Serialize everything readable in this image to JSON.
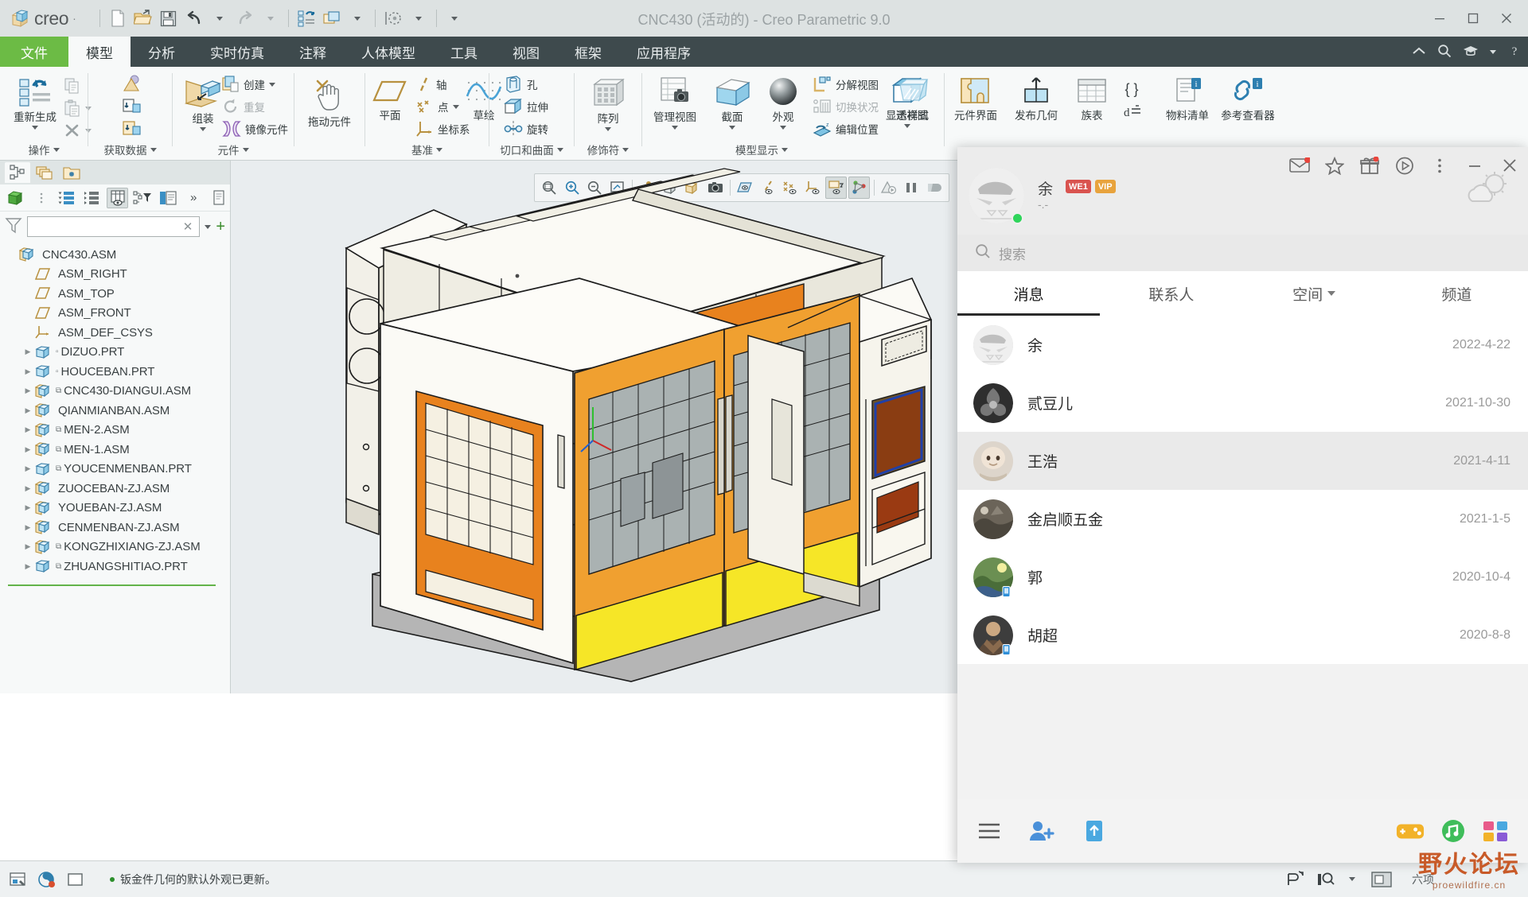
{
  "window": {
    "title": "CNC430 (活动的) - Creo Parametric 9.0",
    "brand": "creo",
    "brand_dot": "·",
    "minimize": "—",
    "maximize": "☐",
    "close": "✕"
  },
  "quick_access": [
    {
      "name": "new-file",
      "label": "新建"
    },
    {
      "name": "open-file",
      "label": "打开"
    },
    {
      "name": "save-file",
      "label": "保存"
    },
    {
      "name": "undo",
      "label": "撤消"
    },
    {
      "name": "undo-dropdown",
      "label": ""
    },
    {
      "name": "redo",
      "label": "重做"
    },
    {
      "name": "redo-dropdown",
      "label": ""
    },
    {
      "name": "regenerate",
      "label": "重新生成"
    },
    {
      "name": "window",
      "label": "窗口"
    },
    {
      "name": "window-dropdown",
      "label": ""
    },
    {
      "name": "selection-filter",
      "label": "选择过滤器"
    },
    {
      "name": "selection-dropdown",
      "label": ""
    },
    {
      "name": "qat-more",
      "label": "自定义快速访问工具栏"
    }
  ],
  "tabs": [
    {
      "id": "file",
      "label": "文件",
      "active": false,
      "file": true
    },
    {
      "id": "model",
      "label": "模型",
      "active": true
    },
    {
      "id": "analysis",
      "label": "分析",
      "active": false
    },
    {
      "id": "realtime",
      "label": "实时仿真",
      "active": false
    },
    {
      "id": "annotate",
      "label": "注释",
      "active": false
    },
    {
      "id": "manikin",
      "label": "人体模型",
      "active": false
    },
    {
      "id": "tools",
      "label": "工具",
      "active": false
    },
    {
      "id": "view",
      "label": "视图",
      "active": false
    },
    {
      "id": "framework",
      "label": "框架",
      "active": false
    },
    {
      "id": "applications",
      "label": "应用程序",
      "active": false
    }
  ],
  "ribbon": {
    "groups": [
      {
        "id": "operations",
        "label": "操作",
        "has_dropdown": true,
        "big": [
          {
            "name": "regenerate",
            "label": "重新生成",
            "dropdown": true
          }
        ],
        "small": [
          {
            "name": "copy",
            "label": "",
            "disabled": true
          },
          {
            "name": "paste",
            "label": "",
            "disabled": true,
            "dropdown": true
          },
          {
            "name": "delete",
            "label": "",
            "disabled": true,
            "dropdown": true
          }
        ]
      },
      {
        "id": "get-data",
        "label": "获取数据",
        "has_dropdown": true,
        "small": [
          {
            "name": "import",
            "label": ""
          },
          {
            "name": "shrinkwrap",
            "label": ""
          },
          {
            "name": "merge-inherit",
            "label": ""
          }
        ]
      },
      {
        "id": "component",
        "label": "元件",
        "has_dropdown": true,
        "big": [
          {
            "name": "assemble",
            "label": "组装",
            "dropdown": true
          }
        ],
        "small": [
          {
            "name": "create",
            "label": "创建",
            "dropdown": true
          },
          {
            "name": "repeat",
            "label": "重复",
            "disabled": true
          },
          {
            "name": "mirror-component",
            "label": "镜像元件"
          }
        ]
      },
      {
        "id": "drag",
        "label": "",
        "big": [
          {
            "name": "drag-component",
            "label": "拖动元件"
          }
        ]
      },
      {
        "id": "datum",
        "label": "基准",
        "has_dropdown": true,
        "big": [
          {
            "name": "plane",
            "label": "平面"
          },
          {
            "name": "sketch",
            "label": "草绘"
          }
        ],
        "small": [
          {
            "name": "axis",
            "label": "轴"
          },
          {
            "name": "point",
            "label": "点",
            "dropdown": true
          },
          {
            "name": "coordinate-system",
            "label": "坐标系"
          }
        ]
      },
      {
        "id": "cut-surface",
        "label": "切口和曲面",
        "has_dropdown": true,
        "small": [
          {
            "name": "hole",
            "label": "孔"
          },
          {
            "name": "extrude",
            "label": "拉伸"
          },
          {
            "name": "revolve",
            "label": "旋转"
          }
        ]
      },
      {
        "id": "modifier",
        "label": "修饰符",
        "has_dropdown": true,
        "big": [
          {
            "name": "pattern",
            "label": "阵列",
            "dropdown": true
          }
        ]
      },
      {
        "id": "model-display",
        "label": "模型显示",
        "has_dropdown": true,
        "big": [
          {
            "name": "manage-views",
            "label": "管理视图",
            "dropdown": true
          },
          {
            "name": "section",
            "label": "截面",
            "dropdown": true
          },
          {
            "name": "appearance",
            "label": "外观",
            "dropdown": true
          },
          {
            "name": "display-style",
            "label": "显示样式",
            "dropdown": true
          },
          {
            "name": "perspective-view",
            "label": "透视图"
          }
        ],
        "small": [
          {
            "name": "exploded-view",
            "label": "分解视图"
          },
          {
            "name": "switch-state",
            "label": "切换状况",
            "disabled": true
          },
          {
            "name": "edit-position",
            "label": "编辑位置"
          }
        ]
      },
      {
        "id": "right-group",
        "label": "",
        "big": [
          {
            "name": "component-interface",
            "label": "元件界面"
          },
          {
            "name": "publish-geometry",
            "label": "发布几何"
          },
          {
            "name": "family-table",
            "label": "族表"
          },
          {
            "name": "relations",
            "label": "",
            "dropdown": false
          },
          {
            "name": "bom",
            "label": "物料清单"
          },
          {
            "name": "reference-viewer",
            "label": "参考查看器"
          }
        ]
      }
    ]
  },
  "left_panel": {
    "tabs": [
      {
        "name": "model-tree",
        "label": "模型树",
        "active": true
      },
      {
        "name": "layers",
        "label": "层",
        "active": false
      },
      {
        "name": "folder-browser",
        "label": "文件夹浏览器",
        "active": false
      }
    ],
    "toolbar": [
      {
        "name": "display-model",
        "label": ""
      },
      {
        "name": "tree-options",
        "label": ""
      },
      {
        "name": "expand-all",
        "label": ""
      },
      {
        "name": "collapse-all",
        "label": ""
      },
      {
        "name": "tree-columns",
        "label": "",
        "on": true
      },
      {
        "name": "tree-filters",
        "label": ""
      },
      {
        "name": "tree-settings",
        "label": ""
      },
      {
        "name": "more",
        "label": "»"
      },
      {
        "name": "tree-menu",
        "label": ""
      }
    ],
    "filter": {
      "value": "",
      "placeholder": ""
    },
    "tree": [
      {
        "name": "CNC430.ASM",
        "icon": "assembly-root",
        "depth": 0,
        "arrow": false,
        "mark": ""
      },
      {
        "name": "ASM_RIGHT",
        "icon": "plane",
        "depth": 1,
        "arrow": false,
        "mark": ""
      },
      {
        "name": "ASM_TOP",
        "icon": "plane",
        "depth": 1,
        "arrow": false,
        "mark": ""
      },
      {
        "name": "ASM_FRONT",
        "icon": "plane",
        "depth": 1,
        "arrow": false,
        "mark": ""
      },
      {
        "name": "ASM_DEF_CSYS",
        "icon": "csys",
        "depth": 1,
        "arrow": false,
        "mark": ""
      },
      {
        "name": "DIZUO.PRT",
        "icon": "part",
        "depth": 1,
        "arrow": true,
        "mark": "▫"
      },
      {
        "name": "HOUCEBAN.PRT",
        "icon": "part",
        "depth": 1,
        "arrow": true,
        "mark": "▫"
      },
      {
        "name": "CNC430-DIANGUI.ASM",
        "icon": "assembly",
        "depth": 1,
        "arrow": true,
        "mark": "⧉"
      },
      {
        "name": "QIANMIANBAN.ASM",
        "icon": "assembly",
        "depth": 1,
        "arrow": true,
        "mark": ""
      },
      {
        "name": "MEN-2.ASM",
        "icon": "assembly",
        "depth": 1,
        "arrow": true,
        "mark": "⧉"
      },
      {
        "name": "MEN-1.ASM",
        "icon": "assembly",
        "depth": 1,
        "arrow": true,
        "mark": "⧉"
      },
      {
        "name": "YOUCENMENBAN.PRT",
        "icon": "part",
        "depth": 1,
        "arrow": true,
        "mark": "⧉"
      },
      {
        "name": "ZUOCEBAN-ZJ.ASM",
        "icon": "assembly",
        "depth": 1,
        "arrow": true,
        "mark": ""
      },
      {
        "name": "YOUEBAN-ZJ.ASM",
        "icon": "assembly",
        "depth": 1,
        "arrow": true,
        "mark": ""
      },
      {
        "name": "CENMENBAN-ZJ.ASM",
        "icon": "assembly",
        "depth": 1,
        "arrow": true,
        "mark": ""
      },
      {
        "name": "KONGZHIXIANG-ZJ.ASM",
        "icon": "assembly",
        "depth": 1,
        "arrow": true,
        "mark": "⧉"
      },
      {
        "name": "ZHUANGSHITIAO.PRT",
        "icon": "part",
        "depth": 1,
        "arrow": true,
        "mark": "⧉"
      }
    ]
  },
  "graphics": {
    "nav_buttons": [
      {
        "name": "zoom-to-fit-box-icon",
        "on": false
      },
      {
        "name": "zoom-in-icon",
        "on": false
      },
      {
        "name": "zoom-out-icon",
        "on": false
      },
      {
        "name": "refit-icon",
        "on": false
      },
      {
        "name": "reorient-icon",
        "on": false
      },
      {
        "name": "saved-orientations-icon",
        "on": false
      },
      {
        "name": "view-manager-icon",
        "on": false
      },
      {
        "name": "snapshot-icon",
        "on": false
      },
      {
        "name": "datum-display-icon",
        "on": false
      },
      {
        "name": "axis-display-icon",
        "on": false
      },
      {
        "name": "point-display-icon",
        "on": false
      },
      {
        "name": "csys-display-icon",
        "on": false
      },
      {
        "name": "annotation-display-icon",
        "on": true
      },
      {
        "name": "spin-center-icon",
        "on": true
      },
      {
        "name": "appearance-gallery-icon",
        "on": false
      },
      {
        "name": "pause-icon",
        "on": false
      },
      {
        "name": "stop-icon",
        "on": false
      }
    ]
  },
  "statusbar": {
    "message": "钣金件几何的默认外观已更新。",
    "icons_left": [
      {
        "name": "selection-filter-icon"
      },
      {
        "name": "appearance-icon"
      },
      {
        "name": "display-toggle-icon"
      }
    ],
    "icons_right": [
      {
        "name": "regenerate-status-icon"
      },
      {
        "name": "search-tool-icon"
      },
      {
        "name": "search-dropdown-icon"
      },
      {
        "name": "full-screen-icon"
      }
    ],
    "selection_text": "六项"
  },
  "qq": {
    "header": {
      "user_name": "余",
      "badges": [
        {
          "label": "WE1",
          "color": "#d9534f"
        },
        {
          "label": "VIP",
          "color": "#e8a33d"
        }
      ],
      "signature": "-.-",
      "icons": [
        {
          "name": "qq-mail-icon"
        },
        {
          "name": "qq-favorites-star-icon"
        },
        {
          "name": "qq-gift-icon"
        },
        {
          "name": "qq-video-icon"
        },
        {
          "name": "qq-more-menu-icon"
        },
        {
          "name": "qq-minimize-icon",
          "label": "—"
        },
        {
          "name": "qq-close-icon",
          "label": "✕"
        }
      ]
    },
    "search": {
      "placeholder": "搜索",
      "value": ""
    },
    "tabs": [
      {
        "name": "tab-messages",
        "label": "消息",
        "active": true,
        "caret": false
      },
      {
        "name": "tab-contacts",
        "label": "联系人",
        "active": false,
        "caret": false
      },
      {
        "name": "tab-space",
        "label": "空间",
        "active": false,
        "caret": true
      },
      {
        "name": "tab-channel",
        "label": "频道",
        "active": false,
        "caret": false
      }
    ],
    "conversations": [
      {
        "name": "余",
        "date": "2022-4-22",
        "selected": false,
        "avatar": "#ededed",
        "mini": ""
      },
      {
        "name": "贰豆儿",
        "date": "2021-10-30",
        "selected": false,
        "avatar": "#3b3b3b",
        "mini": ""
      },
      {
        "name": "王浩",
        "date": "2021-4-11",
        "selected": true,
        "avatar": "#d6cfc7",
        "mini": ""
      },
      {
        "name": "金启顺五金",
        "date": "2021-1-5",
        "selected": false,
        "avatar": "#6f6b63",
        "mini": ""
      },
      {
        "name": "郭",
        "date": "2020-10-4",
        "selected": false,
        "avatar": "#5a7e4d",
        "mini": "qq-mobile-icon"
      },
      {
        "name": "胡超",
        "date": "2020-8-8",
        "selected": false,
        "avatar": "#4a4a4a",
        "mini": "qq-mobile-icon"
      }
    ],
    "footer": {
      "left": [
        {
          "name": "qq-menu-icon"
        },
        {
          "name": "qq-add-friend-icon"
        },
        {
          "name": "qq-file-transfer-icon"
        }
      ],
      "right": [
        {
          "name": "qq-game-icon"
        },
        {
          "name": "qq-music-icon"
        },
        {
          "name": "qq-app-grid-icon"
        }
      ]
    }
  },
  "watermark": {
    "main": "野火论坛",
    "sub": "proewildfire.cn"
  },
  "colors": {
    "file_tab_green": "#6cbb45",
    "ribbon_dark": "#3e4a4d",
    "titlebar": "#dde2e2",
    "accent_blue": "#4aa3d6"
  }
}
